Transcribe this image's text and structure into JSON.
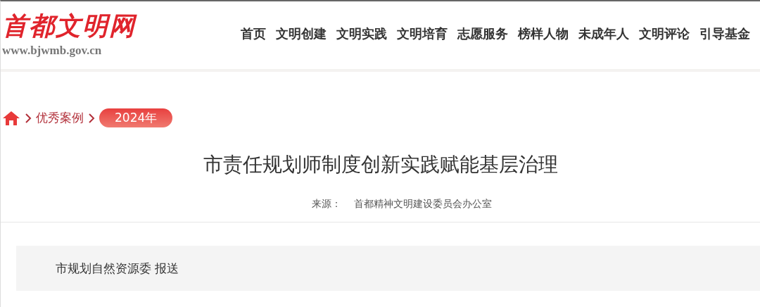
{
  "logo": {
    "name": "首都文明网",
    "url": "www.bjwmb.gov.cn"
  },
  "nav": [
    {
      "label": "首页"
    },
    {
      "label": "文明创建"
    },
    {
      "label": "文明实践"
    },
    {
      "label": "文明培育"
    },
    {
      "label": "志愿服务"
    },
    {
      "label": "榜样人物"
    },
    {
      "label": "未成年人"
    },
    {
      "label": "文明评论"
    },
    {
      "label": "引导基金"
    }
  ],
  "breadcrumb": [
    {
      "label": "优秀案例",
      "selected": false
    },
    {
      "label": "2024年",
      "selected": true
    }
  ],
  "article": {
    "title": "市责任规划师制度创新实践赋能基层治理",
    "source_label": "来源：",
    "source": "首都精神文明建设委员会办公室",
    "summary": "市规划自然资源委 报送"
  }
}
